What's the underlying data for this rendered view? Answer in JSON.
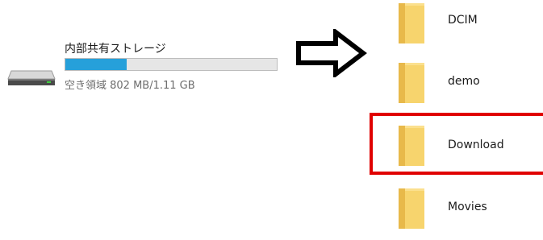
{
  "drive": {
    "name": "内部共有ストレージ",
    "free_space": "空き領域 802 MB/1.11 GB",
    "used_fraction": 0.29,
    "bar_color": "#26a0da",
    "icon": "hard-drive-icon"
  },
  "arrow_icon": "right-arrow-icon",
  "folders": [
    {
      "label": "DCIM",
      "icon": "folder-icon"
    },
    {
      "label": "demo",
      "icon": "folder-icon"
    },
    {
      "label": "Download",
      "icon": "folder-icon",
      "highlighted": true
    },
    {
      "label": "Movies",
      "icon": "folder-icon"
    }
  ],
  "colors": {
    "highlight": "#e00000",
    "folder": "#f3cd6b"
  }
}
